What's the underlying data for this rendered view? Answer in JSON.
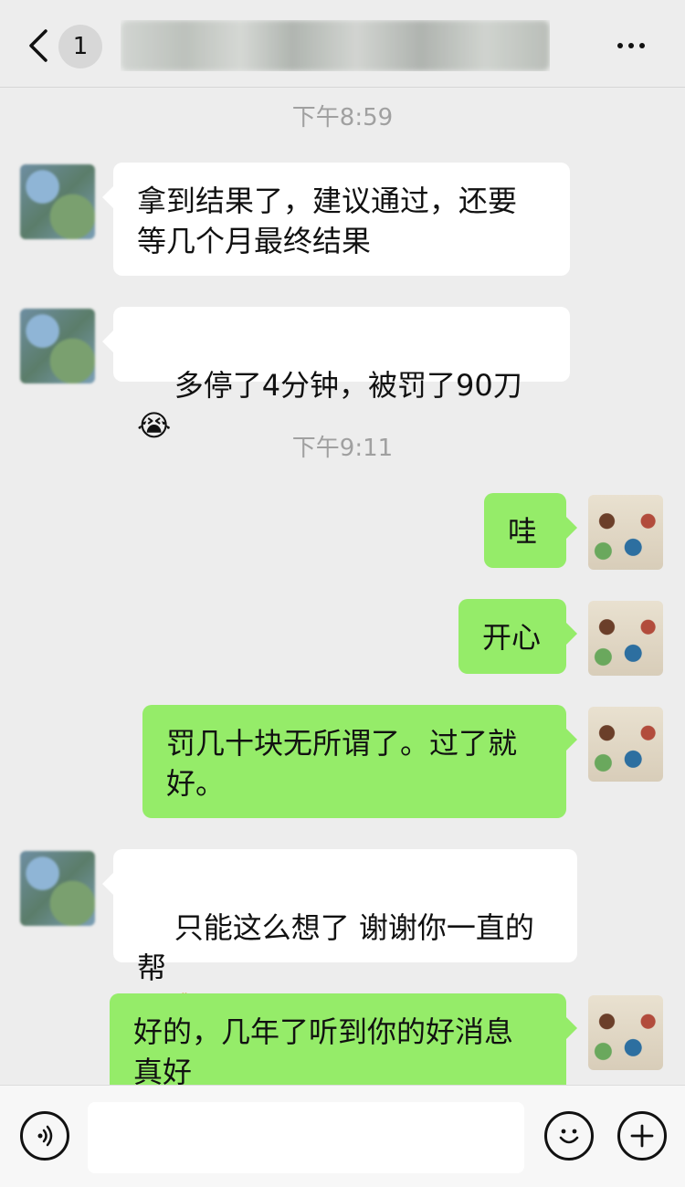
{
  "header": {
    "back_icon": "chevron-left-icon",
    "unread_count": "1",
    "title": "",
    "more_icon": "ellipsis-icon"
  },
  "messages": [
    {
      "type": "timestamp",
      "text": "下午8:59"
    },
    {
      "type": "message",
      "side": "left",
      "text": "拿到结果了，建议通过，还要\n等几个月最终结果"
    },
    {
      "type": "message",
      "side": "left",
      "text": "多停了4分钟，被罚了90刀",
      "emoji": "😭"
    },
    {
      "type": "timestamp",
      "text": "下午9:11"
    },
    {
      "type": "message",
      "side": "right",
      "text": "哇"
    },
    {
      "type": "message",
      "side": "right",
      "text": "开心"
    },
    {
      "type": "message",
      "side": "right",
      "text": "罚几十块无所谓了。过了就\n好。"
    },
    {
      "type": "message",
      "side": "left",
      "text": "只能这么想了 谢谢你一直的帮\n助",
      "emoji": "🙏"
    },
    {
      "type": "message",
      "side": "right",
      "text": "好的，几年了听到你的好消息\n真好"
    }
  ],
  "input_bar": {
    "voice_icon": "voice-icon",
    "emoji_icon": "smiley-icon",
    "plus_icon": "plus-icon",
    "placeholder": ""
  },
  "colors": {
    "background": "#ededed",
    "bubble_left": "#ffffff",
    "bubble_right": "#95ec69",
    "timestamp": "#a0a0a0"
  }
}
